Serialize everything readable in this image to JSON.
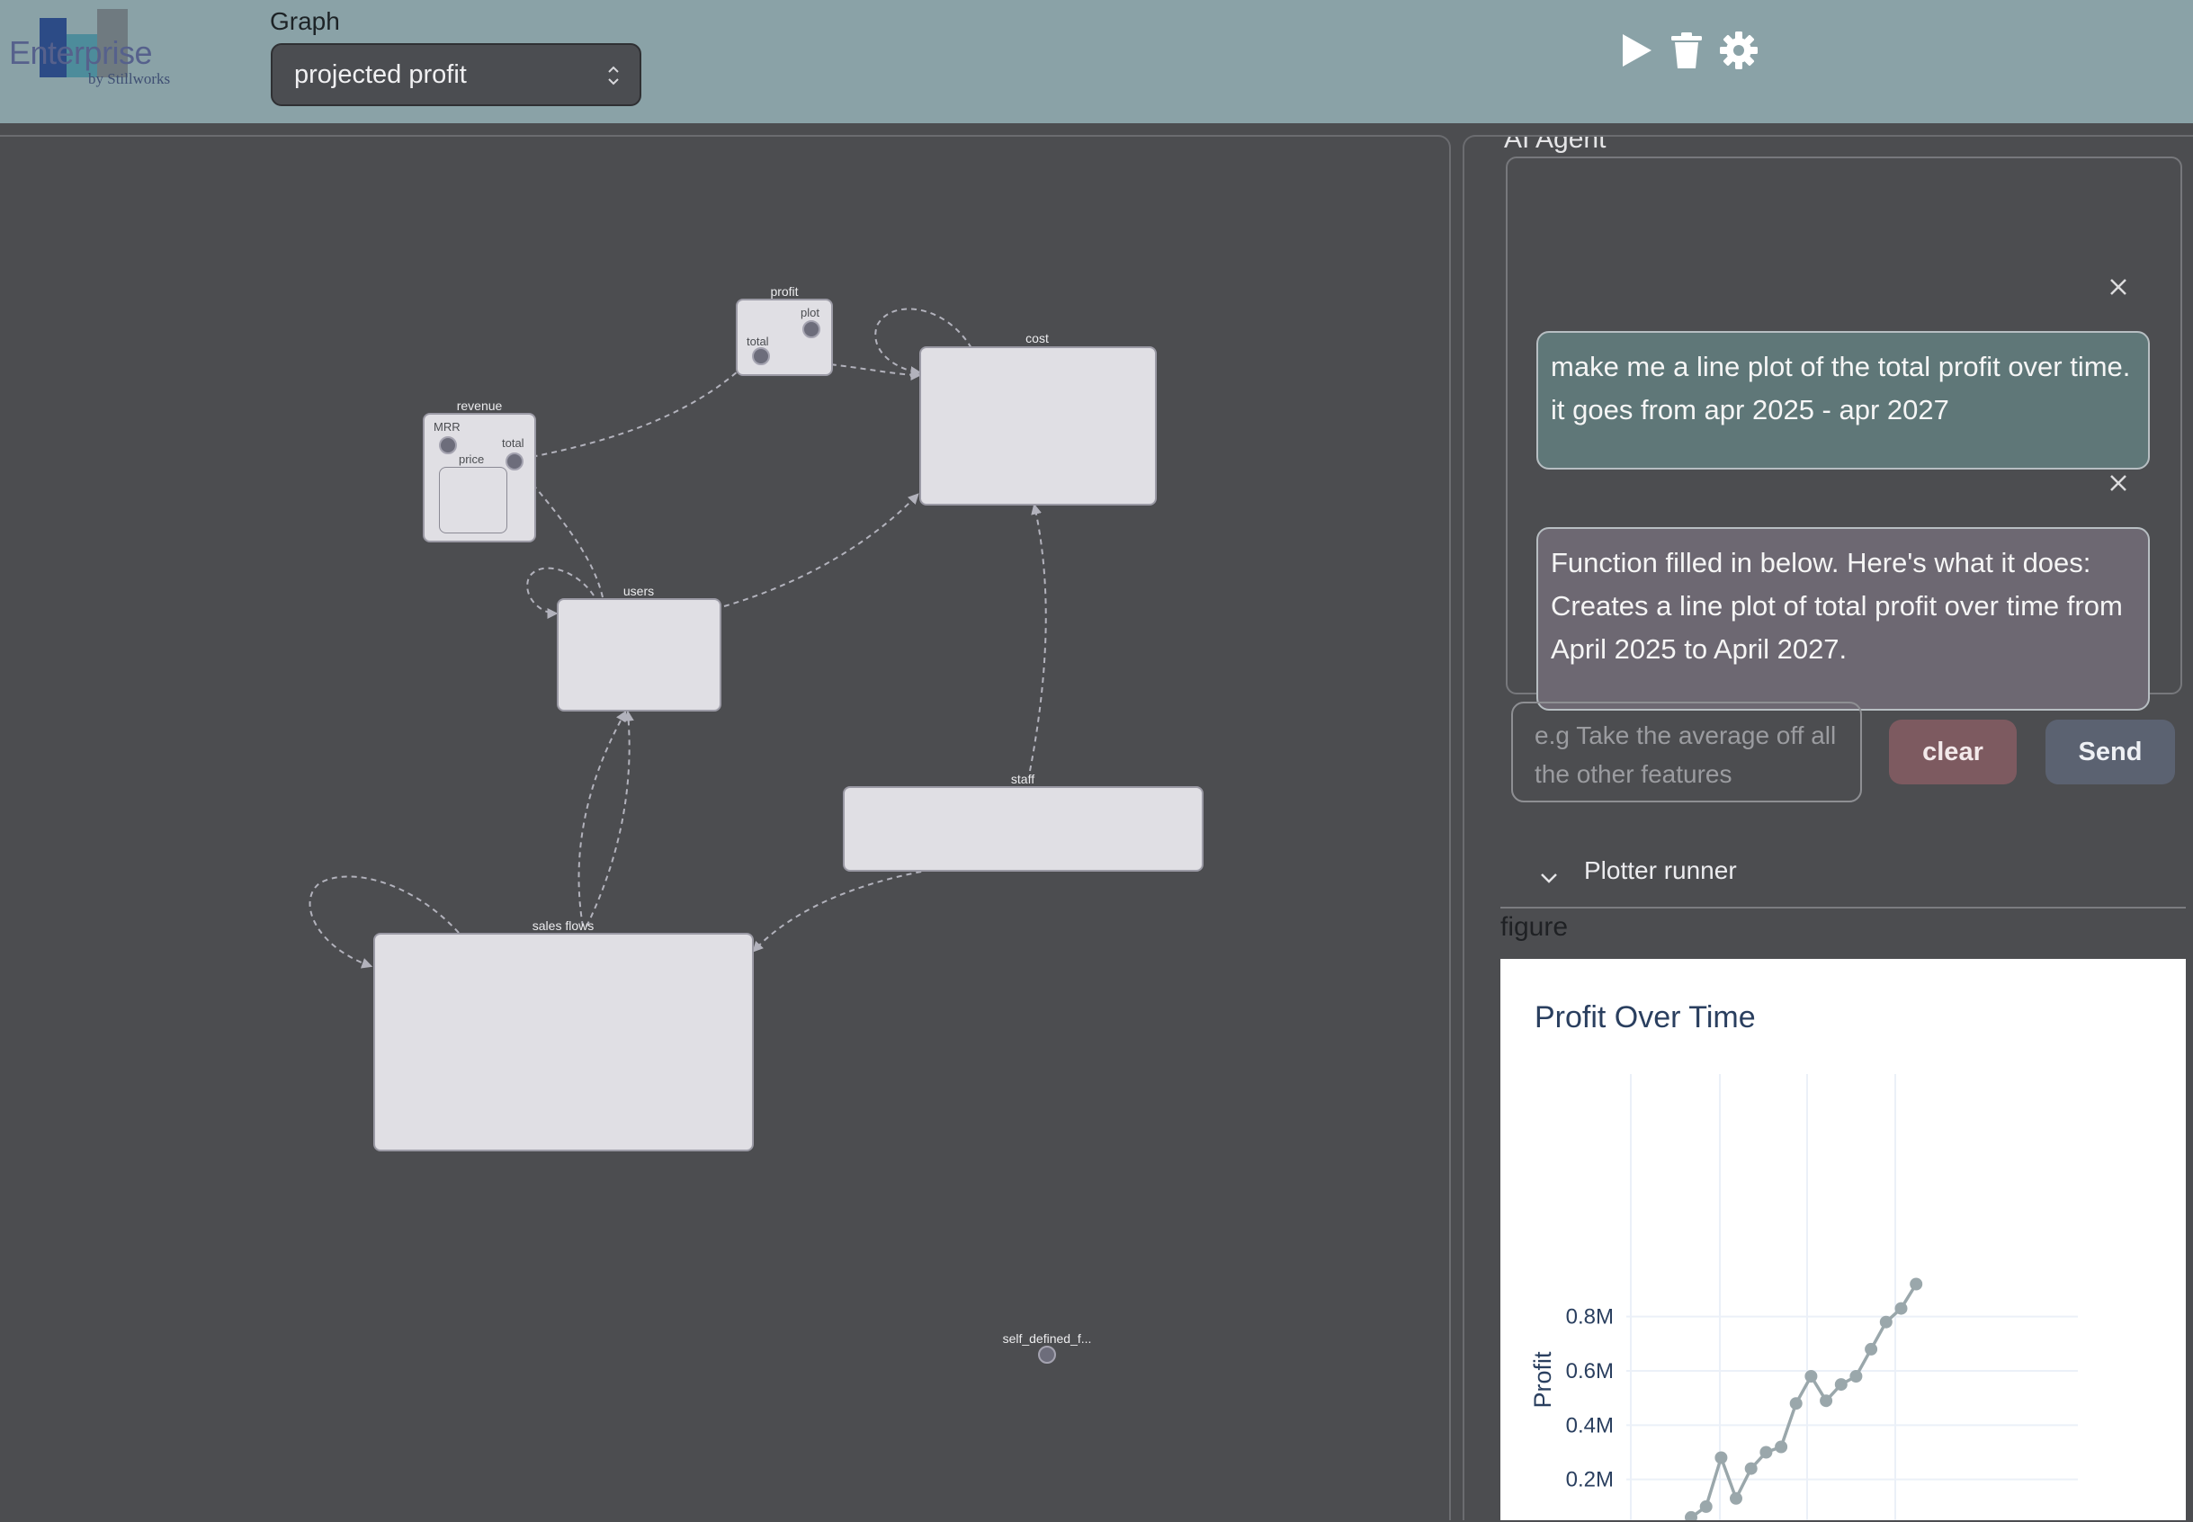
{
  "app": {
    "logo_word": "Enterprise",
    "logo_byline": "by Stillworks"
  },
  "toolbar": {
    "graph_label": "Graph",
    "graph_selected": "projected profit",
    "icons": [
      "play-icon",
      "trash-icon",
      "gear-icon"
    ]
  },
  "graph": {
    "nodes": {
      "profit": {
        "title": "profit",
        "ports": [
          "plot",
          "total"
        ]
      },
      "cost": {
        "title": "cost"
      },
      "revenue": {
        "title": "revenue",
        "ports": [
          "MRR",
          "total"
        ],
        "child": "price"
      },
      "users": {
        "title": "users"
      },
      "staff": {
        "title": "staff"
      },
      "sales_flows": {
        "title": "sales flows"
      },
      "self_defined": {
        "title": "self_defined_f..."
      }
    }
  },
  "agent": {
    "title": "AI Agent",
    "messages": [
      {
        "role": "user",
        "text": "make me a line plot of the total profit over time. it goes from apr 2025 - apr 2027"
      },
      {
        "role": "assistant",
        "text": "Function filled in below. Here's what it does: Creates a line plot of total profit over time from April 2025 to April 2027."
      }
    ],
    "input_placeholder": "e.g Take the average off all the other features",
    "clear_label": "clear",
    "send_label": "Send"
  },
  "plotter": {
    "section_label": "Plotter runner",
    "figure_label": "figure"
  },
  "colors": {
    "topbar": "#8aa2a7",
    "background": "#4c4d50",
    "user_bubble": "#5f7778",
    "assistant_bubble": "#6d6872",
    "clear_button": "#7d5a60",
    "send_button": "#5b6271",
    "plot_line": "#9aa7ab"
  },
  "chart_data": {
    "type": "line",
    "title": "Profit Over Time",
    "xlabel": "",
    "ylabel": "Profit",
    "y_tick_labels": [
      "0.2M",
      "0.4M",
      "0.6M",
      "0.8M"
    ],
    "y_ticks": [
      200000,
      400000,
      600000,
      800000
    ],
    "grid": true,
    "series": [
      {
        "values": [
          60000,
          100000,
          280000,
          130000,
          240000,
          300000,
          320000,
          480000,
          580000,
          490000,
          550000,
          580000,
          680000,
          780000,
          830000,
          920000
        ]
      }
    ]
  }
}
